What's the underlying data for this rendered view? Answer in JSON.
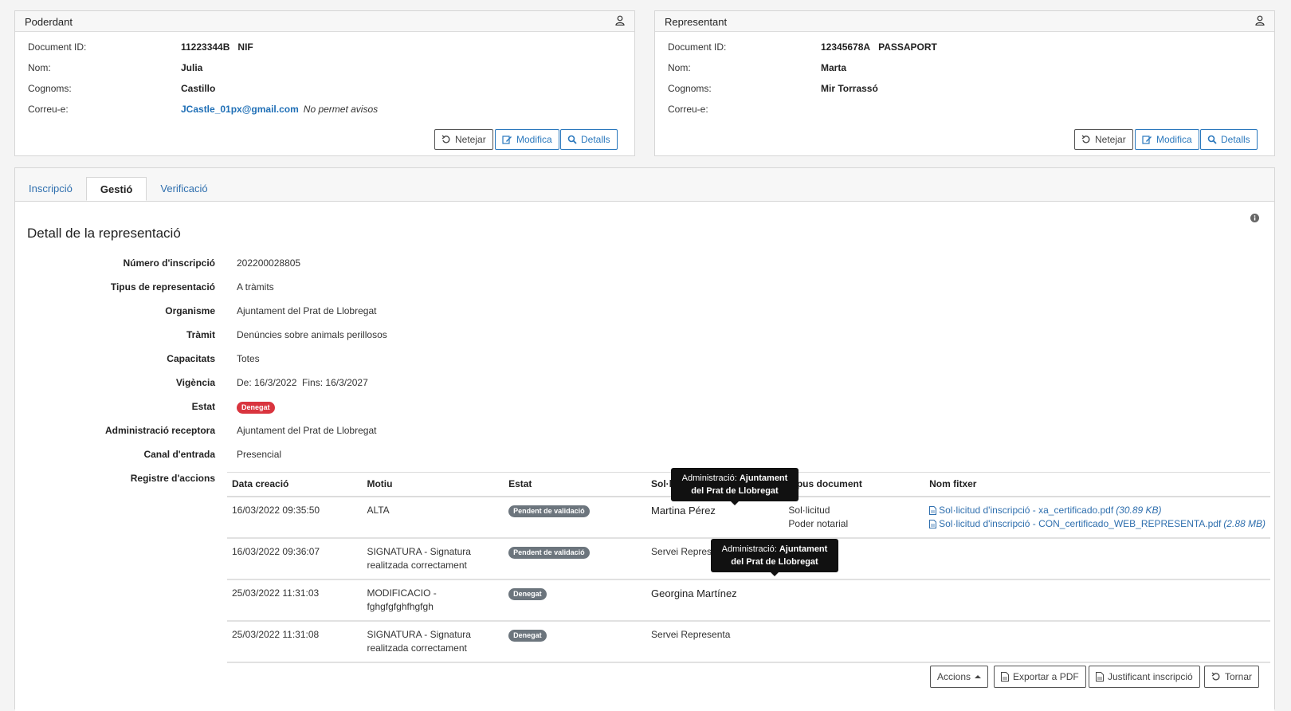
{
  "poderdant": {
    "title": "Poderdant",
    "labels": {
      "doc": "Document ID:",
      "nom": "Nom:",
      "cognoms": "Cognoms:",
      "correu": "Correu-e:"
    },
    "doc_id": "11223344B",
    "doc_type": "NIF",
    "nom": "Julia",
    "cognoms": "Castillo",
    "email": "JCastle_01px@gmail.com",
    "email_note": "No permet avisos",
    "buttons": {
      "netejar": "Netejar",
      "modifica": "Modifica",
      "detalls": "Detalls"
    }
  },
  "representant": {
    "title": "Representant",
    "labels": {
      "doc": "Document ID:",
      "nom": "Nom:",
      "cognoms": "Cognoms:",
      "correu": "Correu-e:"
    },
    "doc_id": "12345678A",
    "doc_type": "PASSAPORT",
    "nom": "Marta",
    "cognoms": "Mir Torrassó",
    "email": "",
    "buttons": {
      "netejar": "Netejar",
      "modifica": "Modifica",
      "detalls": "Detalls"
    }
  },
  "tabs": [
    "Inscripció",
    "Gestió",
    "Verificació"
  ],
  "active_tab": "Gestió",
  "detail": {
    "title": "Detall de la representació",
    "rows": [
      {
        "label": "Número d'inscripció",
        "value": "202200028805"
      },
      {
        "label": "Tipus de representació",
        "value": "A tràmits"
      },
      {
        "label": "Organisme",
        "value": "Ajuntament del Prat de Llobregat"
      },
      {
        "label": "Tràmit",
        "value": "Denúncies sobre animals perillosos"
      },
      {
        "label": "Capacitats",
        "value": "Totes"
      },
      {
        "label": "Vigència",
        "value": "De: 16/3/2022  Fins: 16/3/2027"
      },
      {
        "label": "Estat",
        "value": "Denegat"
      },
      {
        "label": "Administració receptora",
        "value": "Ajuntament del Prat de Llobregat"
      },
      {
        "label": "Canal d'entrada",
        "value": "Presencial"
      },
      {
        "label": "Registre d'accions",
        "value": ""
      }
    ]
  },
  "actions_table": {
    "headers": [
      "Data creació",
      "Motiu",
      "Estat",
      "Sol·licitant",
      "Tipus document",
      "Nom fitxer"
    ],
    "rows": [
      {
        "date": "16/03/2022 09:35:50",
        "motiu": "ALTA",
        "estat": "Pendent de validació",
        "actor": "Martina Pérez",
        "docs": [
          "Sol·licitud",
          "Poder notarial"
        ],
        "files": [
          {
            "name": "Sol·licitud d'inscripció - xa_certificado.pdf",
            "size": "(30.89 KB)"
          },
          {
            "name": "Sol·licitud d'inscripció - CON_certificado_WEB_REPRESENTA.pdf",
            "size": "(2.88 MB)"
          }
        ]
      },
      {
        "date": "16/03/2022 09:36:07",
        "motiu": "SIGNATURA - Signatura realitzada correctament",
        "estat": "Pendent de validació",
        "actor": "Servei Representa",
        "docs": [],
        "files": []
      },
      {
        "date": "25/03/2022 11:31:03",
        "motiu": "MODIFICACIO - fghgfgfghfhgfgh",
        "estat": "Denegat",
        "actor": "Georgina Martínez",
        "docs": [],
        "files": []
      },
      {
        "date": "25/03/2022 11:31:08",
        "motiu": "SIGNATURA - Signatura realitzada correctament",
        "estat": "Denegat",
        "actor": "Servei Representa",
        "docs": [],
        "files": []
      }
    ]
  },
  "tooltips": [
    {
      "label": "Administració:",
      "value": "Ajuntament del Prat de Llobregat"
    },
    {
      "label": "Administració:",
      "value": "Ajuntament del Prat de Llobregat"
    }
  ],
  "footer_buttons": {
    "accions": "Accions",
    "exportar": "Exportar a PDF",
    "justificant": "Justificant inscripció",
    "tornar": "Tornar"
  },
  "colors": {
    "accent": "#2a78bd",
    "danger": "#d9343e",
    "muted": "#6c757d"
  }
}
